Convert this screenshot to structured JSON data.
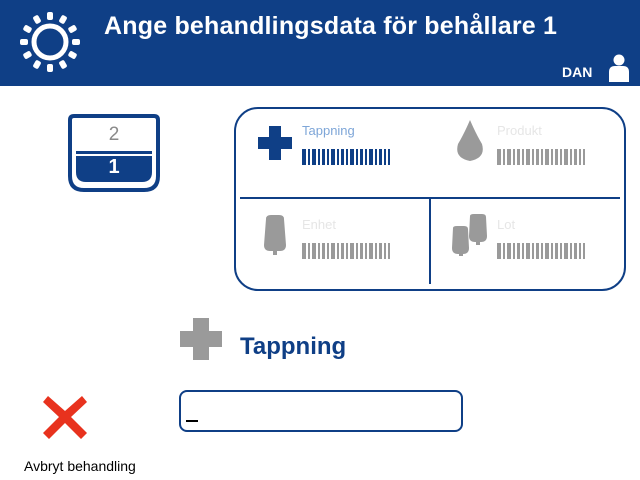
{
  "header": {
    "title": "Ange behandlingsdata för behållare 1",
    "user_label": "DAN",
    "bg_color": "#0f3f86"
  },
  "container_selector": {
    "top": "2",
    "bottom": "1"
  },
  "panel": {
    "items": [
      {
        "label": "Tappning",
        "icon": "cross-icon",
        "state": "active"
      },
      {
        "label": "Produkt",
        "icon": "drop-icon",
        "state": "inactive"
      },
      {
        "label": "Enhet",
        "icon": "bag-icon",
        "state": "inactive"
      },
      {
        "label": "Lot",
        "icon": "bags-icon",
        "state": "inactive"
      }
    ]
  },
  "section": {
    "title": "Tappning"
  },
  "input": {
    "value": "",
    "placeholder": ""
  },
  "cancel": {
    "label": "Avbryt behandling",
    "color": "#e8321e"
  },
  "colors": {
    "accent": "#0f3f86",
    "inactive": "#9a9a9a",
    "active_label": "#7ea6d8"
  }
}
